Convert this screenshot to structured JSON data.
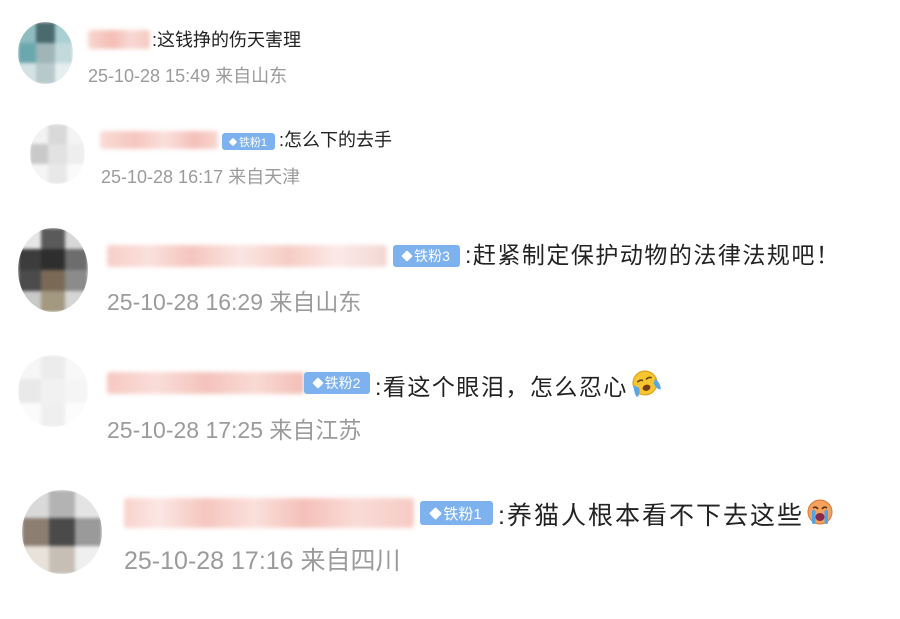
{
  "comments": [
    {
      "text": ":这钱挣的伤天害理",
      "meta": "25-10-28 15:49 来自山东"
    },
    {
      "badge": "铁粉1",
      "text": ":怎么下的去手",
      "meta": "25-10-28 16:17 来自天津"
    },
    {
      "badge": "铁粉3",
      "text": ":赶紧制定保护动物的法律法规吧！",
      "meta": "25-10-28 16:29 来自山东"
    },
    {
      "badge": "铁粉2",
      "text": ":看这个眼泪，怎么忍心",
      "emoji": "crying-face-icon",
      "meta": "25-10-28 17:25 来自江苏"
    },
    {
      "badge": "铁粉1",
      "text": ":养猫人根本看不下去这些",
      "emoji": "loudly-crying-face-icon",
      "meta": "25-10-28 17:16 来自四川"
    }
  ],
  "colors": {
    "text": "#222222",
    "meta": "#9b9b9b",
    "badge_bg": "#7eb2ee",
    "name_blur": "#f4b8b0"
  }
}
